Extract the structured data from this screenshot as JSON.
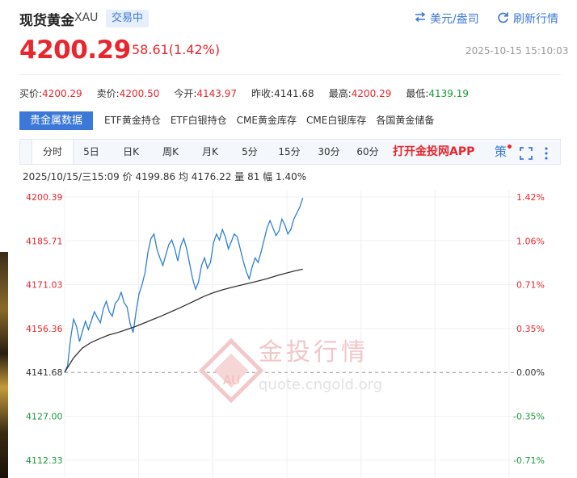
{
  "header": {
    "name": "现货黄金",
    "code": "XAU",
    "status_badge": "交易中",
    "currency_link": "美元/盎司",
    "refresh_link": "刷新行情",
    "price": "4200.29",
    "change": "58.61(1.42%)",
    "timestamp": "2025-10-15 15:10:03"
  },
  "quotes": [
    {
      "label": "买价:",
      "value": "4200.29",
      "color": "red"
    },
    {
      "label": "卖价:",
      "value": "4200.50",
      "color": "red"
    },
    {
      "label": "今开:",
      "value": "4143.97",
      "color": "red"
    },
    {
      "label": "昨收:",
      "value": "4141.68",
      "color": "neutral"
    },
    {
      "label": "最高:",
      "value": "4200.29",
      "color": "red"
    },
    {
      "label": "最低:",
      "value": "4139.19",
      "color": "green"
    }
  ],
  "tabs": [
    "贵金属数据",
    "ETF黄金持仓",
    "ETF白银持仓",
    "CME黄金库存",
    "CME白银库存",
    "各国黄金储备"
  ],
  "chart_tabs": [
    "分时",
    "5日",
    "日K",
    "周K",
    "月K",
    "5分",
    "15分",
    "30分",
    "60分"
  ],
  "app_link": "打开金投网APP",
  "tools": {
    "strategy": "策",
    "fullscreen_icon": "fullscreen-icon",
    "more_icon": "more-icon"
  },
  "info": {
    "datetime": "2025/10/15/三15:09",
    "price_label": "价",
    "price": "4199.86",
    "avg_label": "均",
    "avg": "4176.22",
    "vol_label": "量",
    "vol": "81",
    "amp_label": "幅",
    "amp": "1.40%"
  },
  "watermark": {
    "text": "金投行情",
    "url": "quote.cngold.org",
    "logo": "AU"
  },
  "colors": {
    "up": "#e8262d",
    "down": "#1a9a3a",
    "accent": "#3c78d8",
    "price_line": "#2f7fd1",
    "avg_line": "#333333"
  },
  "chart_data": {
    "type": "line",
    "xlabel": "",
    "ylabel": "",
    "y_ticks": [
      "4200.39",
      "4185.71",
      "4171.03",
      "4156.36",
      "4141.68",
      "4127.00",
      "4112.33"
    ],
    "pct_ticks": [
      "1.42%",
      "1.06%",
      "0.71%",
      "0.35%",
      "0.00%",
      "-0.35%",
      "-0.71%"
    ],
    "ylim": [
      4112.33,
      4200.39
    ],
    "reference": 4141.68,
    "sessions_total": 420,
    "series": [
      {
        "role": "price",
        "values": [
          4141.68,
          4144.0,
          4153.0,
          4159.5,
          4157.0,
          4152.0,
          4155.5,
          4158.8,
          4156.0,
          4159.0,
          4162.0,
          4160.0,
          4158.3,
          4163.0,
          4165.5,
          4162.0,
          4160.5,
          4164.8,
          4166.0,
          4168.5,
          4165.0,
          4163.5,
          4158.0,
          4155.0,
          4162.0,
          4168.0,
          4171.0,
          4175.0,
          4182.0,
          4186.5,
          4188.0,
          4183.0,
          4180.0,
          4177.5,
          4181.0,
          4184.5,
          4186.0,
          4183.0,
          4179.0,
          4184.0,
          4186.5,
          4183.0,
          4178.0,
          4173.0,
          4169.5,
          4172.0,
          4177.5,
          4180.0,
          4176.5,
          4178.5,
          4185.0,
          4188.0,
          4186.0,
          4189.5,
          4187.0,
          4183.0,
          4185.5,
          4188.0,
          4187.0,
          4183.0,
          4179.0,
          4175.5,
          4173.0,
          4177.0,
          4180.0,
          4178.5,
          4182.0,
          4186.0,
          4190.0,
          4192.5,
          4190.0,
          4187.5,
          4189.0,
          4193.0,
          4191.0,
          4188.0,
          4189.5,
          4193.0,
          4195.0,
          4197.0,
          4200.1
        ]
      },
      {
        "role": "average",
        "values": [
          4141.68,
          4146.5,
          4149.8,
          4151.7,
          4153.0,
          4154.2,
          4155.0,
          4156.0,
          4157.0,
          4158.2,
          4159.4,
          4160.6,
          4161.9,
          4163.2,
          4164.6,
          4166.0,
          4167.4,
          4168.5,
          4169.4,
          4170.2,
          4170.9,
          4171.6,
          4172.3,
          4173.1,
          4174.0,
          4174.8,
          4175.6,
          4176.22
        ]
      }
    ]
  }
}
